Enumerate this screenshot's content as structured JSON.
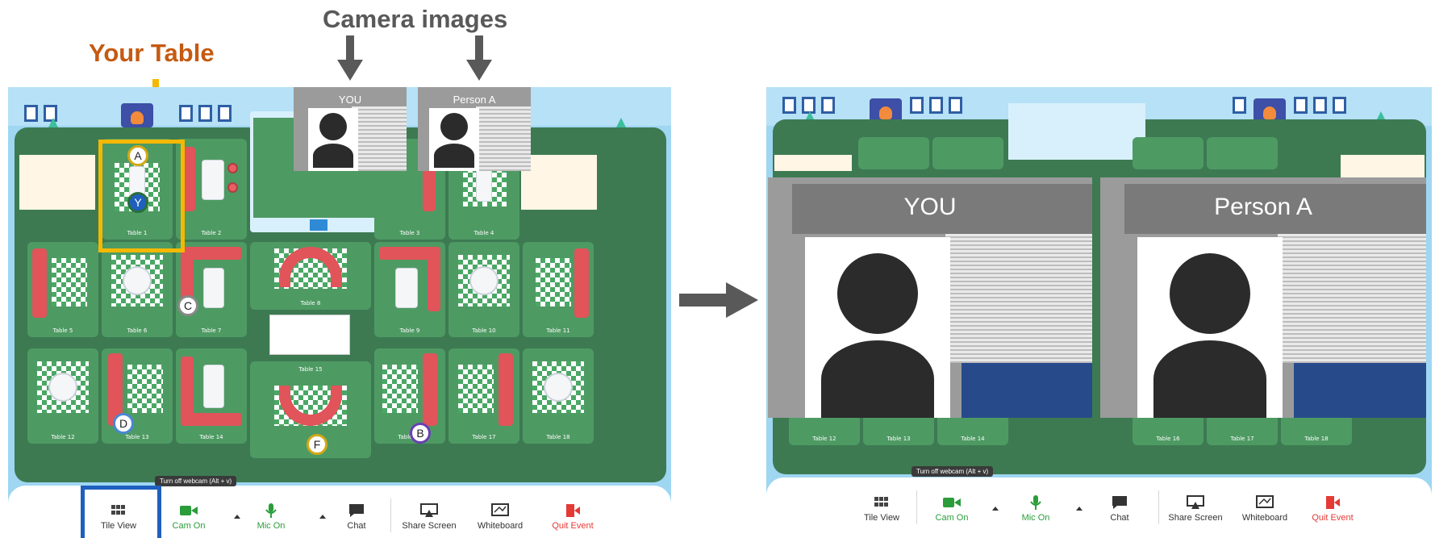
{
  "annotations": {
    "camera_images": "Camera images",
    "your_table": "Your Table"
  },
  "tables": {
    "t1": "Table 1",
    "t2": "Table 2",
    "t3": "Table 3",
    "t4": "Table 4",
    "t5": "Table 5",
    "t6": "Table 6",
    "t7": "Table 7",
    "t8": "Table 8",
    "t9": "Table 9",
    "t10": "Table 10",
    "t11": "Table 11",
    "t12": "Table 12",
    "t13": "Table 13",
    "t14": "Table 14",
    "t15": "Table 15",
    "t16": "Table 16",
    "t17": "Table 17",
    "t18": "Table 18"
  },
  "participants": {
    "a": "A",
    "b": "B",
    "c": "C",
    "d": "D",
    "f": "F",
    "y": "Y"
  },
  "camera_tiles": {
    "you": "YOU",
    "person_a": "Person A"
  },
  "toolbar": {
    "tile_view": "Tile View",
    "cam_on": "Cam On",
    "mic_on": "Mic On",
    "chat": "Chat",
    "share_screen": "Share Screen",
    "whiteboard": "Whiteboard",
    "quit_event": "Quit Event",
    "tooltip": "Turn off webcam (Alt + v)"
  },
  "colors": {
    "annotation_gray": "#595959",
    "annotation_orange": "#c55a11",
    "highlight_yellow": "#f5b800",
    "highlight_blue": "#1f5fbf",
    "cam_green": "#2a9d3a",
    "quit_red": "#e53935",
    "floor_green": "#3d7a52",
    "sofa_red": "#e0545a"
  },
  "icons": {
    "tile_view": "grid-icon",
    "cam": "video-camera-icon",
    "mic": "microphone-icon",
    "chat": "chat-bubble-icon",
    "share": "share-screen-icon",
    "whiteboard": "whiteboard-icon",
    "quit": "exit-door-icon",
    "arrow": "arrow-right-icon"
  }
}
